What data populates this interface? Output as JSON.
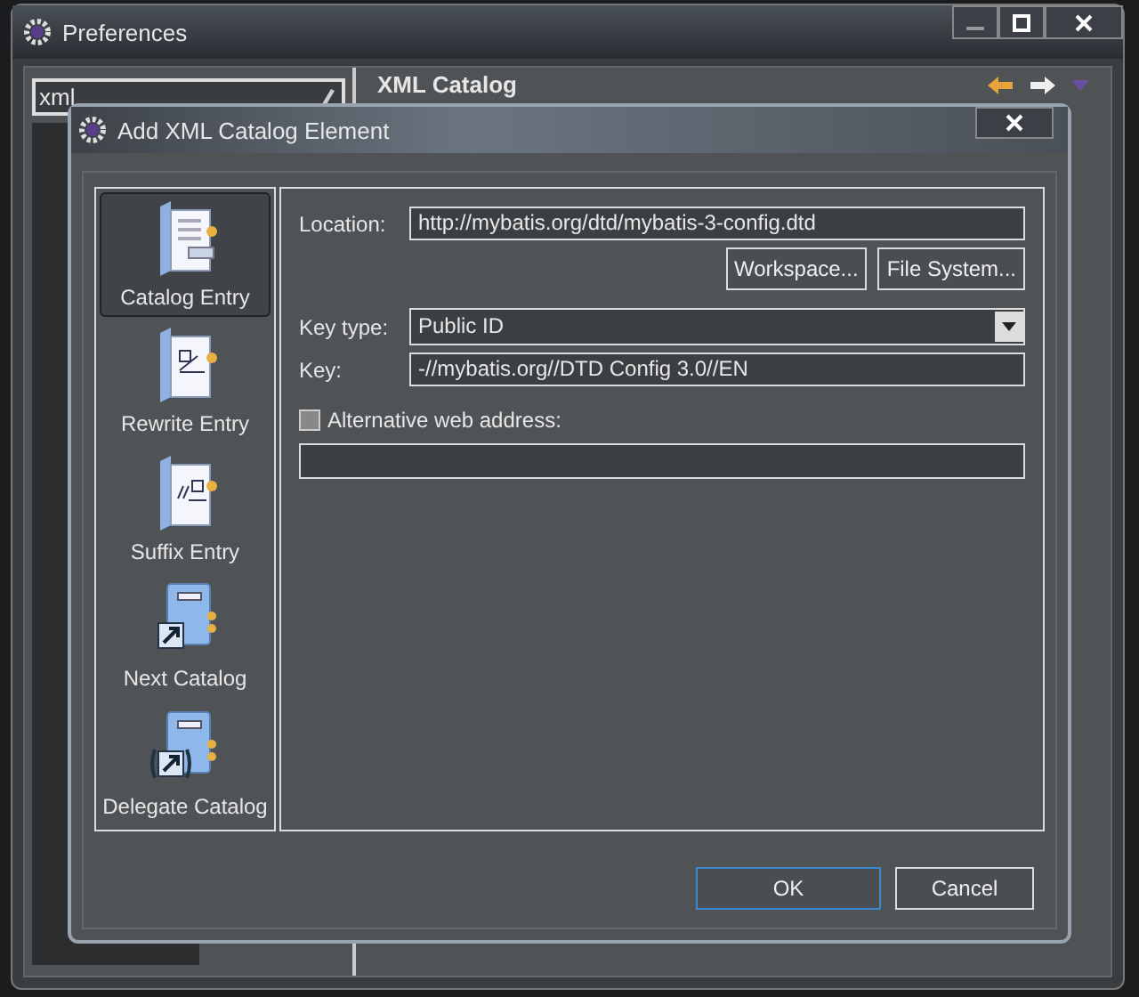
{
  "preferences": {
    "title": "Preferences",
    "filter": "xml",
    "page_title": "XML Catalog"
  },
  "dialog": {
    "title": "Add XML Catalog Element",
    "types": [
      {
        "label": "Catalog Entry",
        "kind": "catalog-entry",
        "selected": true
      },
      {
        "label": "Rewrite Entry",
        "kind": "rewrite-entry",
        "selected": false
      },
      {
        "label": "Suffix Entry",
        "kind": "suffix-entry",
        "selected": false
      },
      {
        "label": "Next Catalog",
        "kind": "next-catalog",
        "selected": false
      },
      {
        "label": "Delegate Catalog",
        "kind": "delegate-catalog",
        "selected": false
      }
    ],
    "location": {
      "label": "Location:",
      "value": "http://mybatis.org/dtd/mybatis-3-config.dtd"
    },
    "browse_buttons": [
      "Workspace...",
      "File System..."
    ],
    "key_type": {
      "label": "Key type:",
      "value": "Public ID"
    },
    "key": {
      "label": "Key:",
      "value": "-//mybatis.org//DTD Config 3.0//EN"
    },
    "alternative": {
      "label": "Alternative web address:",
      "checked": false
    },
    "buttons": [
      {
        "label": "OK",
        "default": true
      },
      {
        "label": "Cancel",
        "default": false
      }
    ]
  }
}
